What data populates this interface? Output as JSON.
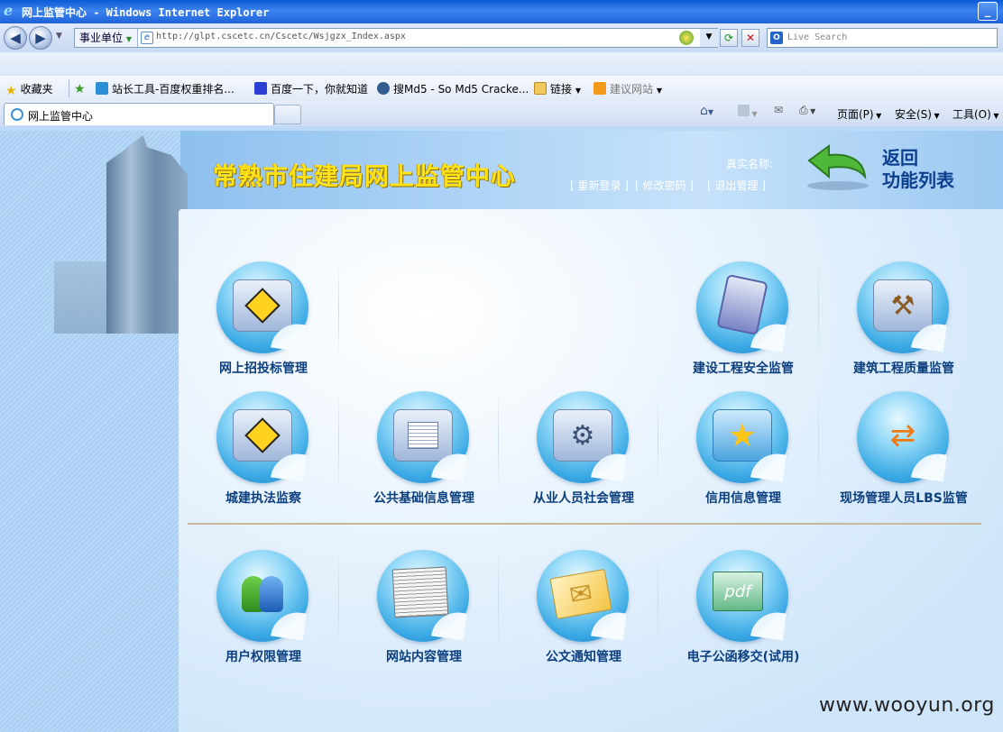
{
  "window": {
    "title": "网上监管中心 - Windows Internet Explorer"
  },
  "address_bar": {
    "zone_label": "事业单位",
    "url": "http://glpt.cscetc.cn/Cscetc/Wsjgzx_Index.aspx",
    "search_placeholder": "Live Search"
  },
  "favorites": {
    "items": [
      {
        "label": "收藏夹",
        "icon": "star-icon"
      },
      {
        "label": "站长工具-百度权重排名...",
        "icon": "chinaz-icon"
      },
      {
        "label": "百度一下，你就知道",
        "icon": "baidu-paw-icon"
      },
      {
        "label": "搜Md5 - So Md5 Cracke...",
        "icon": "md5-icon"
      },
      {
        "label": "链接",
        "icon": "folder-icon"
      },
      {
        "label": "建议网站",
        "icon": "bing-icon"
      }
    ]
  },
  "tab": {
    "title": "网上监管中心"
  },
  "commands": {
    "page": "页面(P)",
    "safety": "安全(S)",
    "tools": "工具(O)"
  },
  "header": {
    "site_title": "常熟市住建局网上监管中心",
    "real_name_label": "真实名称:",
    "links": [
      "[ 重新登录 ]",
      "[ 修改密码 ]",
      "[ 退出管理 ]"
    ],
    "back_line1": "返回",
    "back_line2": "功能列表"
  },
  "tiles": {
    "bidding": "网上招投标管理",
    "safety": "建设工程安全监管",
    "quality": "建筑工程质量监管",
    "enforcement": "城建执法监察",
    "basic_info": "公共基础信息管理",
    "staff": "从业人员社会管理",
    "credit": "信用信息管理",
    "lbs": "现场管理人员LBS监管",
    "user_perm": "用户权限管理",
    "content": "网站内容管理",
    "notice": "公文通知管理",
    "efile": "电子公函移交(试用)"
  },
  "watermark": "www.wooyun.org"
}
